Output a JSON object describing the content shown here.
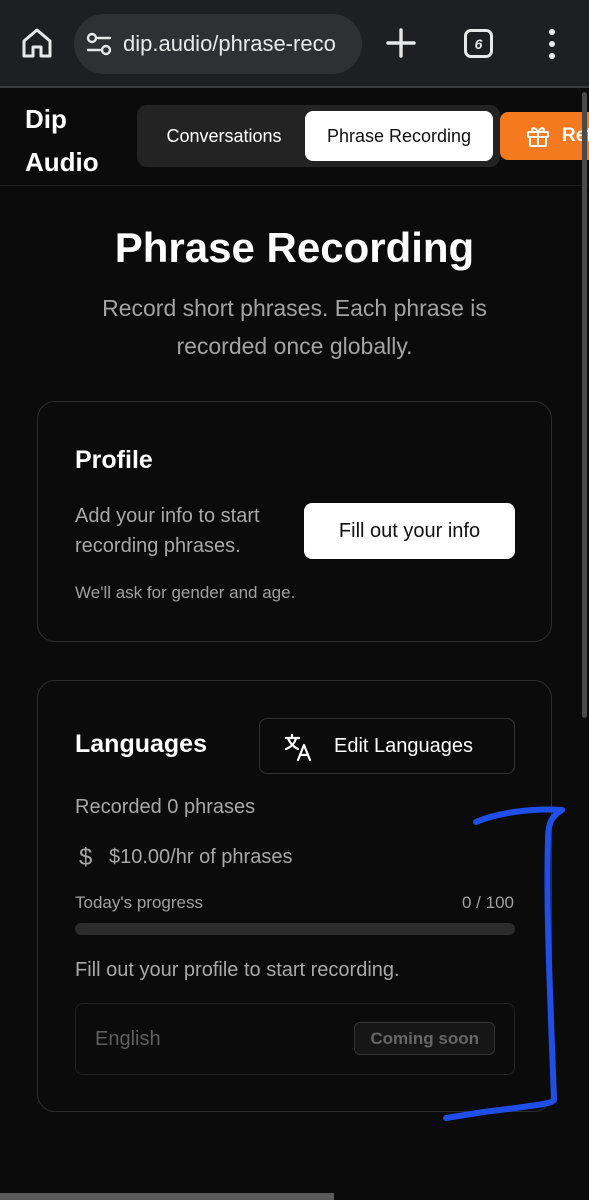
{
  "browser": {
    "url": "dip.audio/phrase-reco",
    "tab_count": "6"
  },
  "header": {
    "brand_line1": "Dip",
    "brand_line2": "Audio",
    "tabs": [
      {
        "label": "Conversations",
        "active": false
      },
      {
        "label": "Phrase Recording",
        "active": true
      }
    ],
    "refer_label": "Ref",
    "refer_color": "#f5791f"
  },
  "hero": {
    "title": "Phrase Recording",
    "subtitle": "Record short phrases. Each phrase is recorded once globally."
  },
  "profile": {
    "title": "Profile",
    "text": "Add your info to start recording phrases.",
    "button": "Fill out your info",
    "note": "We'll ask for gender and age."
  },
  "languages": {
    "title": "Languages",
    "edit_button": "Edit Languages",
    "recorded": "Recorded 0 phrases",
    "currency_symbol": "$",
    "rate": "$10.00/hr of phrases",
    "progress_label": "Today's progress",
    "progress_count": "0 / 100",
    "progress_fraction": 0,
    "fill_message": "Fill out your profile to start recording.",
    "items": [
      {
        "name": "English",
        "badge": "Coming soon"
      }
    ]
  },
  "annotation": {
    "color": "#1f4fe8"
  }
}
